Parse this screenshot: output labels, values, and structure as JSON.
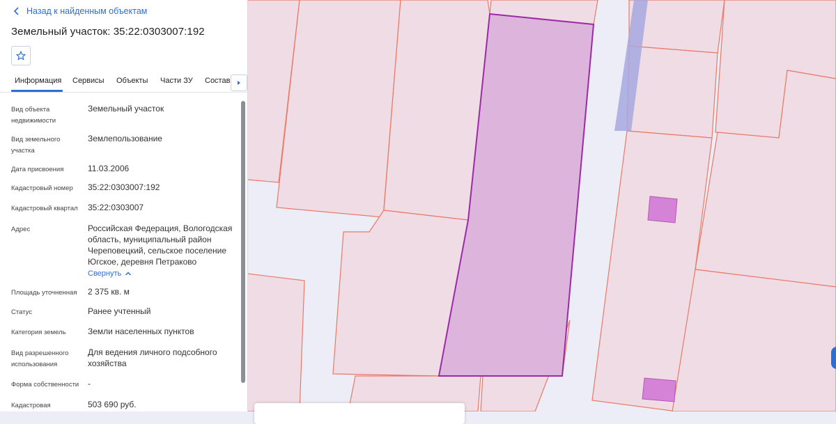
{
  "panel": {
    "back_label": "Назад к найденным объектам",
    "title": "Земельный участок: 35:22:0303007:192",
    "tabs": [
      {
        "label": "Информация"
      },
      {
        "label": "Сервисы"
      },
      {
        "label": "Объекты"
      },
      {
        "label": "Части ЗУ"
      },
      {
        "label": "Состав"
      }
    ],
    "rows": [
      {
        "label": "Вид объекта недвижимости",
        "value": "Земельный участок"
      },
      {
        "label": "Вид земельного участка",
        "value": "Землепользование"
      },
      {
        "label": "Дата присвоения",
        "value": "11.03.2006"
      },
      {
        "label": "Кадастровый номер",
        "value": "35:22:0303007:192"
      },
      {
        "label": "Кадастровый квартал",
        "value": "35:22:0303007"
      },
      {
        "label": "Адрес",
        "value": "Российская Федерация, Вологодская область, муниципальный район Череповецкий, сельское поселение Югское, деревня Петраково",
        "action": "Свернуть"
      },
      {
        "label": "Площадь уточненная",
        "value": "2 375 кв. м"
      },
      {
        "label": "Статус",
        "value": "Ранее учтенный"
      },
      {
        "label": "Категория земель",
        "value": "Земли населенных пунктов"
      },
      {
        "label": "Вид разрешенного использования",
        "value": "Для ведения личного подсобного хозяйства"
      },
      {
        "label": "Форма собственности",
        "value": "-"
      },
      {
        "label": "Кадастровая",
        "value": "503 690 руб."
      }
    ]
  },
  "colors": {
    "accent": "#2b6fd6",
    "parcel_fill": "#f0dce4",
    "parcel_border": "#e87a66",
    "selected_fill": "#dcb4dc",
    "selected_border": "#9b2aa6",
    "building_fill": "#d483d6",
    "road": "#ededf7"
  },
  "icons": [
    "chevron-left-icon",
    "star-icon",
    "chevron-up-icon",
    "caret-right-icon"
  ]
}
